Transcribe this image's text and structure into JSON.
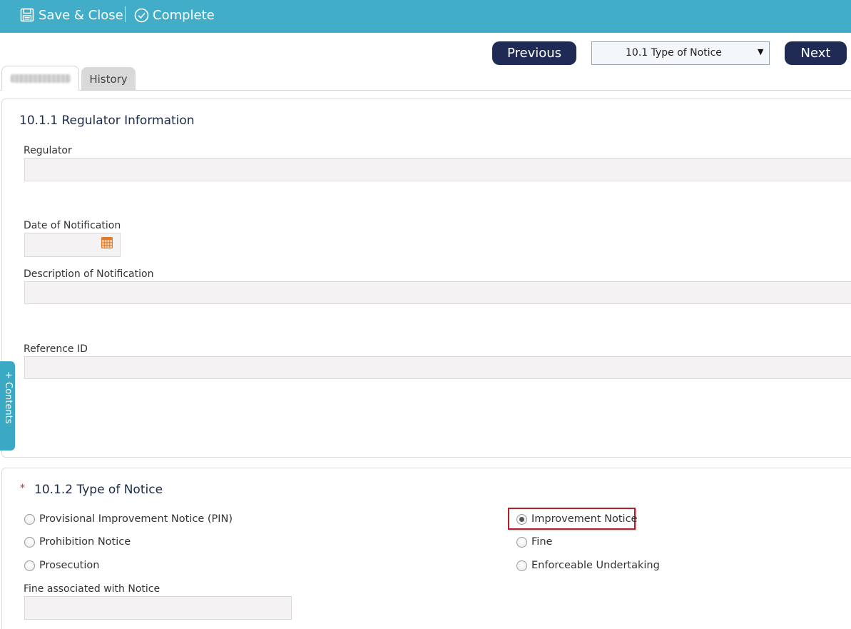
{
  "toolbar": {
    "save_close_label": "Save & Close",
    "complete_label": "Complete"
  },
  "nav": {
    "previous_label": "Previous",
    "next_label": "Next",
    "section_select_value": "10.1 Type of Notice"
  },
  "tabs": [
    {
      "label": "",
      "redacted": true
    },
    {
      "label": "History"
    }
  ],
  "section1": {
    "title": "10.1.1 Regulator Information",
    "fields": {
      "regulator": {
        "label": "Regulator",
        "value": ""
      },
      "date_of_notification": {
        "label": "Date of Notification",
        "value": ""
      },
      "description": {
        "label": "Description of Notification",
        "value": ""
      },
      "reference_id": {
        "label": "Reference ID",
        "value": ""
      }
    }
  },
  "section2": {
    "required_marker": "*",
    "title": "10.1.2 Type of Notice",
    "options": [
      {
        "label": "Provisional Improvement Notice (PIN)",
        "selected": false
      },
      {
        "label": "Improvement Notice",
        "selected": true
      },
      {
        "label": "Prohibition Notice",
        "selected": false
      },
      {
        "label": "Fine",
        "selected": false
      },
      {
        "label": "Prosecution",
        "selected": false
      },
      {
        "label": "Enforceable Undertaking",
        "selected": false
      }
    ],
    "fine_field": {
      "label": "Fine associated with Notice",
      "value": ""
    }
  },
  "side_tab": {
    "label": "+ Contents"
  },
  "colors": {
    "toolbar_bg": "#41adc9",
    "nav_button_bg": "#1f2b54",
    "highlight_border": "#b21f2d",
    "field_bg": "#f4f2f2"
  },
  "icons": {
    "save": "floppy-disk-icon",
    "complete": "check-circle-icon",
    "calendar": "calendar-icon",
    "dropdown": "triangle-down-icon"
  }
}
